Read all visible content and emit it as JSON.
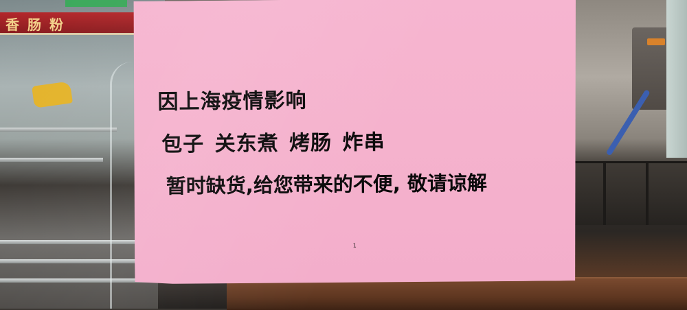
{
  "background": {
    "banner_text": "香肠粉",
    "colors": {
      "banner_red": "#b3262a",
      "banner_text": "#f3d28a",
      "counter_wood": "#6b3f26"
    }
  },
  "notice": {
    "lines": [
      "因上海疫情影响",
      "包子 关东煮 烤肠 炸串",
      "暂时缺货,给您带来的不便, 敬请谅解"
    ],
    "page_number": "1",
    "colors": {
      "paper": "#f5b2cd",
      "text": "#0b0a0b"
    }
  }
}
